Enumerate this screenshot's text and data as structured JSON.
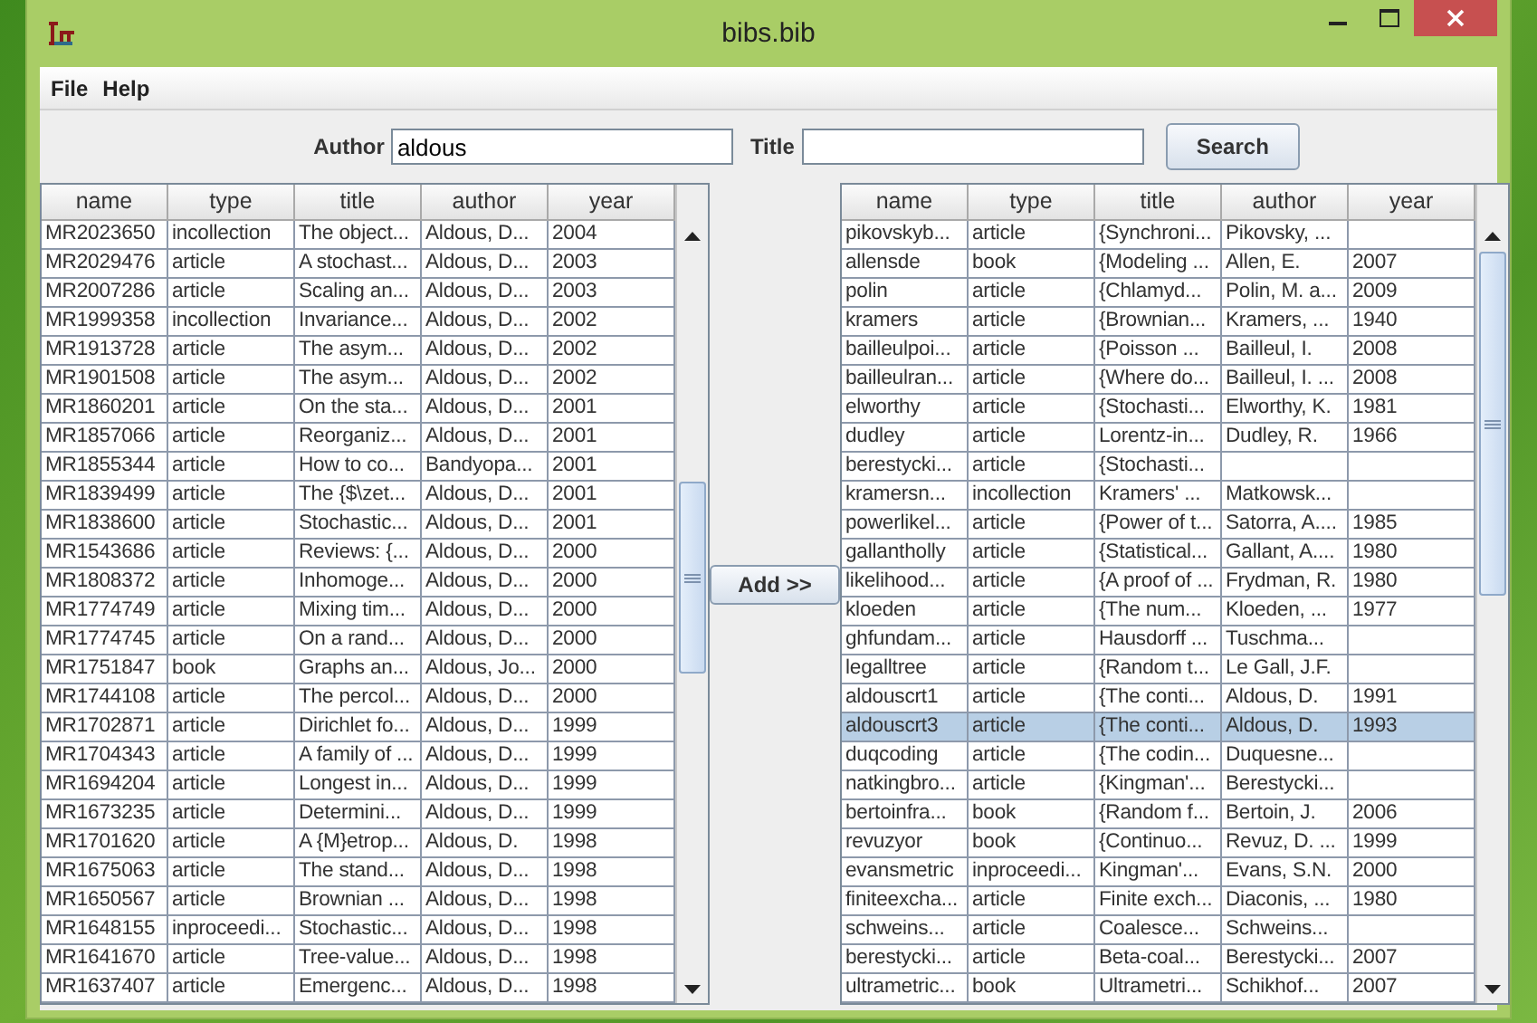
{
  "window": {
    "title": "bibs.bib"
  },
  "menu": [
    {
      "label": "File"
    },
    {
      "label": "Help"
    }
  ],
  "search": {
    "author_label": "Author",
    "author_value": "aldous",
    "title_label": "Title",
    "button": "Search"
  },
  "left_table": {
    "columns": [
      "name",
      "type",
      "title",
      "author",
      "year"
    ],
    "rows": [
      {
        "name": "MR2023650",
        "type": "incollection",
        "title": "The object...",
        "author": "Aldous, D...",
        "year": "2004",
        "selected": false
      },
      {
        "name": "MR2029476",
        "type": "article",
        "title": "A stochast...",
        "author": "Aldous, D...",
        "year": "2003",
        "selected": false
      },
      {
        "name": "MR2007286",
        "type": "article",
        "title": "Scaling an...",
        "author": "Aldous, D...",
        "year": "2003",
        "selected": false
      },
      {
        "name": "MR1999358",
        "type": "incollection",
        "title": "Invariance...",
        "author": "Aldous, D...",
        "year": "2002",
        "selected": false
      },
      {
        "name": "MR1913728",
        "type": "article",
        "title": "The asym...",
        "author": "Aldous, D...",
        "year": "2002",
        "selected": false
      },
      {
        "name": "MR1901508",
        "type": "article",
        "title": "The asym...",
        "author": "Aldous, D...",
        "year": "2002",
        "selected": false
      },
      {
        "name": "MR1860201",
        "type": "article",
        "title": "On the sta...",
        "author": "Aldous, D...",
        "year": "2001",
        "selected": false
      },
      {
        "name": "MR1857066",
        "type": "article",
        "title": "Reorganiz...",
        "author": "Aldous, D...",
        "year": "2001",
        "selected": false
      },
      {
        "name": "MR1855344",
        "type": "article",
        "title": "How to co...",
        "author": "Bandyopa...",
        "year": "2001",
        "selected": false
      },
      {
        "name": "MR1839499",
        "type": "article",
        "title": "The {$\\zet...",
        "author": "Aldous, D...",
        "year": "2001",
        "selected": false
      },
      {
        "name": "MR1838600",
        "type": "article",
        "title": "Stochastic...",
        "author": "Aldous, D...",
        "year": "2001",
        "selected": false
      },
      {
        "name": "MR1543686",
        "type": "article",
        "title": "Reviews: {...",
        "author": "Aldous, D...",
        "year": "2000",
        "selected": false
      },
      {
        "name": "MR1808372",
        "type": "article",
        "title": "Inhomoge...",
        "author": "Aldous, D...",
        "year": "2000",
        "selected": false
      },
      {
        "name": "MR1774749",
        "type": "article",
        "title": "Mixing tim...",
        "author": "Aldous, D...",
        "year": "2000",
        "selected": false
      },
      {
        "name": "MR1774745",
        "type": "article",
        "title": "On a rand...",
        "author": "Aldous, D...",
        "year": "2000",
        "selected": false
      },
      {
        "name": "MR1751847",
        "type": "book",
        "title": "Graphs an...",
        "author": "Aldous, Jo...",
        "year": "2000",
        "selected": false
      },
      {
        "name": "MR1744108",
        "type": "article",
        "title": "The percol...",
        "author": "Aldous, D...",
        "year": "2000",
        "selected": false
      },
      {
        "name": "MR1702871",
        "type": "article",
        "title": "Dirichlet fo...",
        "author": "Aldous, D...",
        "year": "1999",
        "selected": false
      },
      {
        "name": "MR1704343",
        "type": "article",
        "title": "A family of ...",
        "author": "Aldous, D...",
        "year": "1999",
        "selected": false
      },
      {
        "name": "MR1694204",
        "type": "article",
        "title": "Longest in...",
        "author": "Aldous, D...",
        "year": "1999",
        "selected": false
      },
      {
        "name": "MR1673235",
        "type": "article",
        "title": "Determini...",
        "author": "Aldous, D...",
        "year": "1999",
        "selected": false
      },
      {
        "name": "MR1701620",
        "type": "article",
        "title": "A {M}etrop...",
        "author": "Aldous, D.",
        "year": "1998",
        "selected": false
      },
      {
        "name": "MR1675063",
        "type": "article",
        "title": "The stand...",
        "author": "Aldous, D...",
        "year": "1998",
        "selected": false
      },
      {
        "name": "MR1650567",
        "type": "article",
        "title": "Brownian ...",
        "author": "Aldous, D...",
        "year": "1998",
        "selected": false
      },
      {
        "name": "MR1648155",
        "type": "inproceedi...",
        "title": "Stochastic...",
        "author": "Aldous, D...",
        "year": "1998",
        "selected": false
      },
      {
        "name": "MR1641670",
        "type": "article",
        "title": "Tree-value...",
        "author": "Aldous, D...",
        "year": "1998",
        "selected": false
      },
      {
        "name": "MR1637407",
        "type": "article",
        "title": "Emergenc...",
        "author": "Aldous, D...",
        "year": "1998",
        "selected": false
      }
    ]
  },
  "add_button": "Add >>",
  "right_table": {
    "columns": [
      "name",
      "type",
      "title",
      "author",
      "year"
    ],
    "rows": [
      {
        "name": "pikovskyb...",
        "type": "article",
        "title": "{Synchroni...",
        "author": "Pikovsky, ...",
        "selected": false
      },
      {
        "name": "allensde",
        "type": "book",
        "title": "{Modeling ...",
        "author": "Allen, E.",
        "year": "2007",
        "selected": false
      },
      {
        "name": "polin",
        "type": "article",
        "title": "{Chlamyd...",
        "author": "Polin, M. a...",
        "year": "2009",
        "selected": false
      },
      {
        "name": "kramers",
        "type": "article",
        "title": "{Brownian...",
        "author": "Kramers, ...",
        "year": "1940",
        "selected": false
      },
      {
        "name": "bailleulpoi...",
        "type": "article",
        "title": "{Poisson ...",
        "author": "Bailleul, I.",
        "year": "2008",
        "selected": false
      },
      {
        "name": "bailleulran...",
        "type": "article",
        "title": "{Where do...",
        "author": "Bailleul, I. ...",
        "year": "2008",
        "selected": false
      },
      {
        "name": "elworthy",
        "type": "article",
        "title": "{Stochasti...",
        "author": "Elworthy, K.",
        "year": "1981",
        "selected": false
      },
      {
        "name": "dudley",
        "type": "article",
        "title": "Lorentz-in...",
        "author": "Dudley, R.",
        "year": "1966",
        "selected": false
      },
      {
        "name": "berestycki...",
        "type": "article",
        "title": "{Stochasti...",
        "selected": false
      },
      {
        "name": "kramersn...",
        "type": "incollection",
        "title": "Kramers' ...",
        "author": "Matkowsk...",
        "selected": false
      },
      {
        "name": "powerlikel...",
        "type": "article",
        "title": "{Power of t...",
        "author": "Satorra, A....",
        "year": "1985",
        "selected": false
      },
      {
        "name": "gallantholly",
        "type": "article",
        "title": "{Statistical...",
        "author": "Gallant, A....",
        "year": "1980",
        "selected": false
      },
      {
        "name": "likelihood...",
        "type": "article",
        "title": "{A proof of ...",
        "author": "Frydman, R.",
        "year": "1980",
        "selected": false
      },
      {
        "name": "kloeden",
        "type": "article",
        "title": "{The num...",
        "author": "Kloeden, ...",
        "year": "1977",
        "selected": false
      },
      {
        "name": "ghfundam...",
        "type": "article",
        "title": "Hausdorff ...",
        "author": "Tuschma...",
        "selected": false
      },
      {
        "name": "legalltree",
        "type": "article",
        "title": "{Random t...",
        "author": "Le Gall, J.F.",
        "selected": false
      },
      {
        "name": "aldouscrt1",
        "type": "article",
        "title": "{The conti...",
        "author": "Aldous, D.",
        "year": "1991",
        "selected": false
      },
      {
        "name": "aldouscrt3",
        "type": "article",
        "title": "{The conti...",
        "author": "Aldous, D.",
        "year": "1993",
        "selected": true
      },
      {
        "name": "duqcoding",
        "type": "article",
        "title": "{The codin...",
        "author": "Duquesne...",
        "selected": false
      },
      {
        "name": "natkingbro...",
        "type": "article",
        "title": "{Kingman'...",
        "author": "Berestycki...",
        "selected": false
      },
      {
        "name": "bertoinfra...",
        "type": "book",
        "title": "{Random f...",
        "author": "Bertoin, J.",
        "year": "2006",
        "selected": false
      },
      {
        "name": "revuzyor",
        "type": "book",
        "title": "{Continuo...",
        "author": "Revuz, D. ...",
        "year": "1999",
        "selected": false
      },
      {
        "name": "evansmetric",
        "type": "inproceedi...",
        "title": "Kingman'...",
        "author": "Evans, S.N.",
        "year": "2000",
        "selected": false
      },
      {
        "name": "finiteexcha...",
        "type": "article",
        "title": "Finite exch...",
        "author": "Diaconis, ...",
        "year": "1980",
        "selected": false
      },
      {
        "name": "schweins...",
        "type": "article",
        "title": "Coalesce...",
        "author": "Schweins...",
        "selected": false
      },
      {
        "name": "berestycki...",
        "type": "article",
        "title": "Beta-coal...",
        "author": "Berestycki...",
        "year": "2007",
        "selected": false
      },
      {
        "name": "ultrametric...",
        "type": "book",
        "title": "Ultrametri...",
        "author": "Schikhof...",
        "year": "2007",
        "selected": false
      }
    ]
  }
}
